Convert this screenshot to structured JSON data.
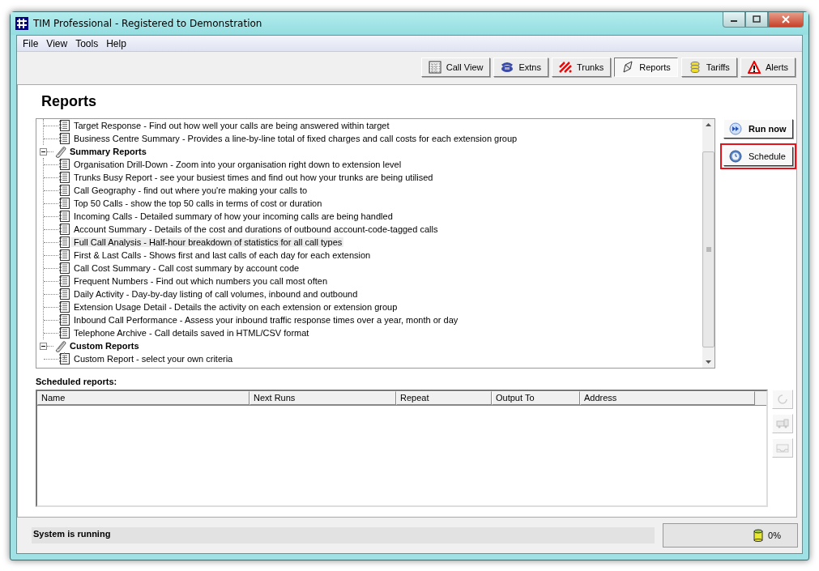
{
  "window": {
    "title": "TIM Professional - Registered to Demonstration"
  },
  "menu": [
    "File",
    "View",
    "Tools",
    "Help"
  ],
  "toolbar": [
    {
      "label": "Call View",
      "selected": false
    },
    {
      "label": "Extns",
      "selected": false
    },
    {
      "label": "Trunks",
      "selected": false
    },
    {
      "label": "Reports",
      "selected": true
    },
    {
      "label": "Tariffs",
      "selected": false
    },
    {
      "label": "Alerts",
      "selected": false
    }
  ],
  "heading": "Reports",
  "tree": [
    {
      "children": [
        {
          "label": "Target Response - Find out how well your calls are being answered within target",
          "selected": false
        },
        {
          "label": "Business Centre Summary - Provides a line-by-line total of fixed charges and call costs for each extension group",
          "selected": false
        }
      ]
    },
    {
      "label": "Summary Reports",
      "expanded": true,
      "children": [
        {
          "label": "Organisation Drill-Down - Zoom into your organisation right down to extension level",
          "selected": false
        },
        {
          "label": "Trunks Busy Report - see your busiest times and find out how your trunks are being utilised",
          "selected": false
        },
        {
          "label": "Call Geography - find out where you're making your calls to",
          "selected": false
        },
        {
          "label": "Top 50 Calls - show the top 50 calls in terms of cost or duration",
          "selected": false
        },
        {
          "label": "Incoming Calls - Detailed summary of how your incoming calls are being handled",
          "selected": false
        },
        {
          "label": "Account Summary - Details of the cost and durations of outbound account-code-tagged calls",
          "selected": false
        },
        {
          "label": "Full Call Analysis - Half-hour breakdown of statistics for all call types",
          "selected": true
        },
        {
          "label": "First & Last Calls - Shows first and last calls of each day for each extension",
          "selected": false
        },
        {
          "label": "Call Cost Summary - Call cost summary by account code",
          "selected": false
        },
        {
          "label": "Frequent Numbers - Find out which numbers you call most often",
          "selected": false
        },
        {
          "label": "Daily Activity - Day-by-day listing of call volumes, inbound and outbound",
          "selected": false
        },
        {
          "label": "Extension Usage Detail - Details the activity on each extension or extension group",
          "selected": false
        },
        {
          "label": "Inbound Call Performance - Assess your inbound traffic response times over a year, month or day",
          "selected": false
        },
        {
          "label": "Telephone Archive - Call details saved in HTML/CSV format",
          "selected": false
        }
      ]
    },
    {
      "label": "Custom Reports",
      "expanded": true,
      "children": [
        {
          "label": "Custom Report - select your own criteria",
          "selected": false
        }
      ]
    }
  ],
  "actions": [
    {
      "label": "Run now",
      "bold": true,
      "highlighted": false
    },
    {
      "label": "Schedule",
      "bold": false,
      "highlighted": true
    }
  ],
  "scheduled": {
    "label": "Scheduled reports:",
    "columns": [
      "Name",
      "Next Runs",
      "Repeat",
      "Output To",
      "Address"
    ]
  },
  "side_buttons": [
    {
      "disabled": true
    },
    {
      "disabled": true
    },
    {
      "disabled": true
    }
  ],
  "status_bar": {
    "message": "System is running",
    "usage": "0%"
  }
}
